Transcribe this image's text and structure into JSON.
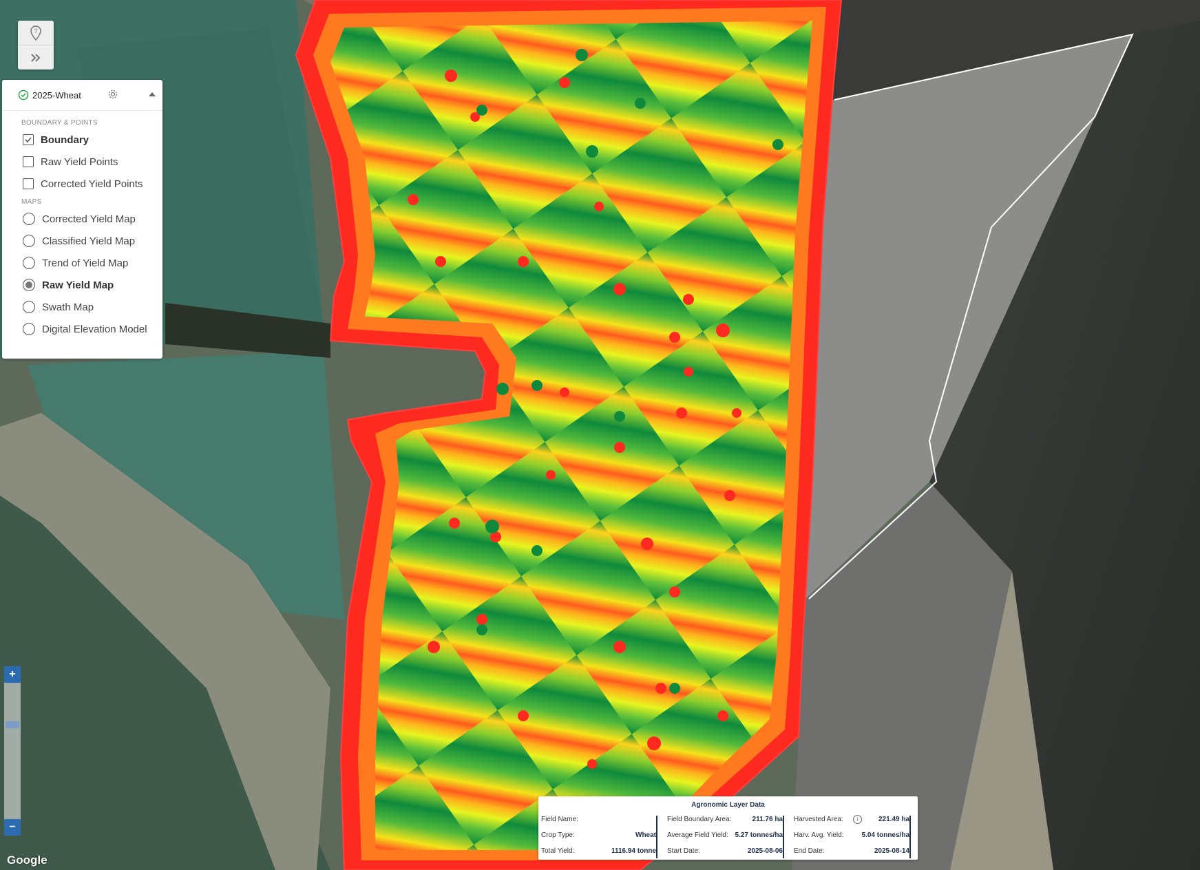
{
  "colors": {
    "accent": "#2b6cb0",
    "yield_low": "#ff2a1f",
    "yield_mid": "#f5ff1a",
    "yield_high": "#0f8a3c",
    "check_green": "#2aa64a"
  },
  "tools": {
    "icons": [
      "location-help-icon",
      "double-chevron-right-icon"
    ]
  },
  "layer_panel": {
    "title": "2025-Wheat",
    "boundary_section_label": "BOUNDARY & POINTS",
    "maps_section_label": "MAPS",
    "checkboxes": [
      {
        "label": "Boundary",
        "checked": true
      },
      {
        "label": "Raw Yield Points",
        "checked": false
      },
      {
        "label": "Corrected Yield Points",
        "checked": false
      }
    ],
    "maps": [
      {
        "label": "Corrected Yield Map",
        "selected": false
      },
      {
        "label": "Classified Yield Map",
        "selected": false
      },
      {
        "label": "Trend of Yield Map",
        "selected": false
      },
      {
        "label": "Raw Yield Map",
        "selected": true
      },
      {
        "label": "Swath Map",
        "selected": false
      },
      {
        "label": "Digital Elevation Model",
        "selected": false
      }
    ]
  },
  "zoom": {
    "plus": "+",
    "minus": "−"
  },
  "attribution": "Google",
  "agronomic": {
    "title": "Agronomic Layer Data",
    "col1": [
      {
        "label": "Field Name:",
        "value": ""
      },
      {
        "label": "Crop Type:",
        "value": "Wheat"
      },
      {
        "label": "Total Yield:",
        "value": "1116.94 tonne"
      }
    ],
    "col2": [
      {
        "label": "Field Boundary Area:",
        "value": "211.76 ha"
      },
      {
        "label": "Average Field Yield:",
        "value": "5.27 tonnes/ha"
      },
      {
        "label": "Start Date:",
        "value": "2025-08-06"
      }
    ],
    "col3": [
      {
        "label": "Harvested Area:",
        "value": "221.49 ha"
      },
      {
        "label": "Harv. Avg. Yield:",
        "value": "5.04 tonnes/ha"
      },
      {
        "label": "End Date:",
        "value": "2025-08-14"
      }
    ],
    "info_icon": "i"
  }
}
